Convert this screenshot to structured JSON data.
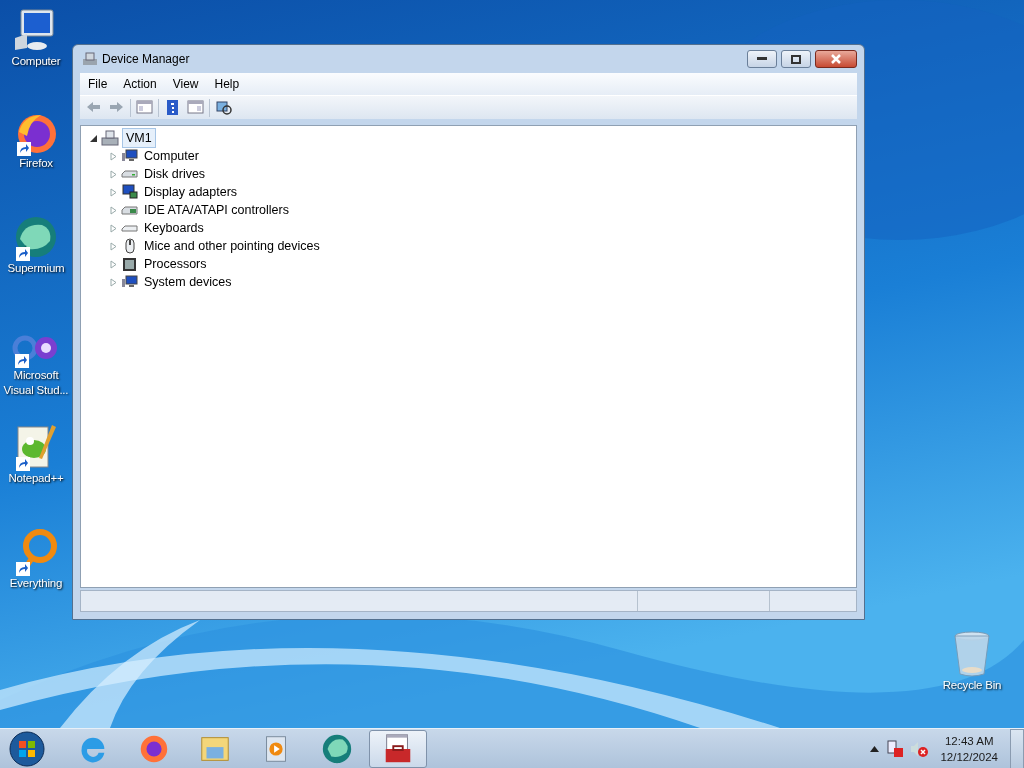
{
  "desktop_icons": [
    {
      "label": "Computer",
      "kind": "computer",
      "shortcut": false
    },
    {
      "label": "Firefox",
      "kind": "firefox",
      "shortcut": true
    },
    {
      "label": "Supermium",
      "kind": "supermium",
      "shortcut": true
    },
    {
      "label": "Microsoft Visual Stud...",
      "kind": "vs",
      "shortcut": true
    },
    {
      "label": "Notepad++",
      "kind": "notepad",
      "shortcut": true
    },
    {
      "label": "Everything",
      "kind": "everything",
      "shortcut": true
    },
    {
      "label": "Recycle Bin",
      "kind": "recycle",
      "shortcut": false
    }
  ],
  "window": {
    "title": "Device Manager",
    "menu": [
      "File",
      "Action",
      "View",
      "Help"
    ],
    "tree": {
      "label": "VM1",
      "expanded": true,
      "selected": true,
      "children": [
        {
          "label": "Computer",
          "kind": "monitor",
          "expanded": false
        },
        {
          "label": "Disk drives",
          "kind": "disk",
          "expanded": false
        },
        {
          "label": "Display adapters",
          "kind": "display",
          "expanded": false
        },
        {
          "label": "IDE ATA/ATAPI controllers",
          "kind": "ide",
          "expanded": false
        },
        {
          "label": "Keyboards",
          "kind": "keyboard",
          "expanded": false
        },
        {
          "label": "Mice and other pointing devices",
          "kind": "mouse",
          "expanded": false
        },
        {
          "label": "Processors",
          "kind": "cpu",
          "expanded": false
        },
        {
          "label": "System devices",
          "kind": "monitor",
          "expanded": false
        }
      ]
    }
  },
  "taskbar": {
    "apps": [
      {
        "kind": "ie",
        "active": false
      },
      {
        "kind": "firefox",
        "active": false
      },
      {
        "kind": "explorer",
        "active": false
      },
      {
        "kind": "media",
        "active": false
      },
      {
        "kind": "supermium",
        "active": false
      },
      {
        "kind": "devmgr",
        "active": true
      }
    ],
    "clock": {
      "time": "12:43 AM",
      "date": "12/12/2024"
    }
  }
}
